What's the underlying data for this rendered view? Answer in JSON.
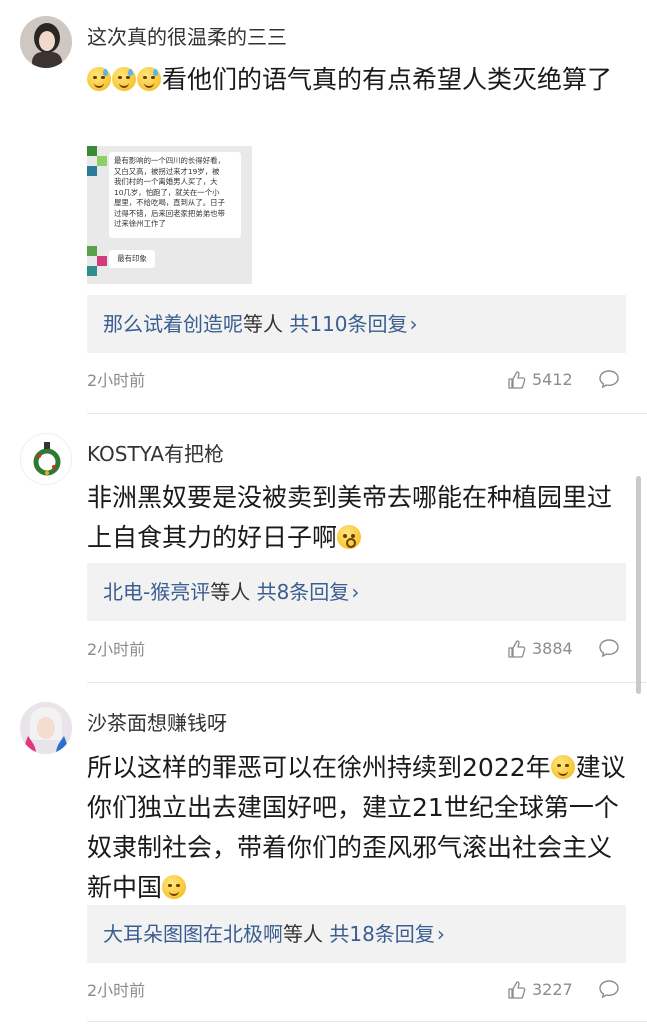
{
  "comments": [
    {
      "username": "这次真的很温柔的三三",
      "avatar_icon": "user-avatar-girl-icon",
      "text": "看他们的语气真的有点希望人类灭绝算了",
      "emojis": [
        "sweat-face-icon",
        "sweat-face-icon",
        "sweat-face-icon"
      ],
      "image": {
        "lines": [
          "最有影响的一个四川的长得好看，",
          "又白又高，被拐过来才19岁，被",
          "我们村的一个离婚男人买了，大",
          "10几岁，怕跑了，就关在一个小",
          "屋里，不给吃喝，直到从了。日子",
          "过得不错，后来回老家把弟弟也带",
          "过来徐州工作了"
        ],
        "second_bubble": "最有印象"
      },
      "reply_name": "那么试着创造呢",
      "reply_mid": "等人",
      "reply_count": "共110条回复",
      "time": "2小时前",
      "likes": "5412"
    },
    {
      "username": "KOSTYA有把枪",
      "avatar_icon": "user-avatar-wreath-icon",
      "text": "非洲黑奴要是没被卖到美帝去哪能在种植园里过上自食其力的好日子啊",
      "emojis": [
        "shocked-face-icon"
      ],
      "reply_name": "北电-猴亮评",
      "reply_mid": "等人",
      "reply_count": "共8条回复",
      "time": "2小时前",
      "likes": "3884"
    },
    {
      "username": "沙茶面想赚钱呀",
      "avatar_icon": "user-avatar-anime-icon",
      "text_part1": "所以这样的罪恶可以在徐州持续到2022年",
      "text_part2": "建议你们独立出去建国好吧，建立21世纪全球第一个奴隶制社会，带着你们的歪风邪气滚出社会主义新中国",
      "emojis": [
        "smile-face-icon",
        "smile-face-icon"
      ],
      "reply_name": "大耳朵图图在北极啊",
      "reply_mid": "等人",
      "reply_count": "共18条回复",
      "time": "2小时前",
      "likes": "3227"
    }
  ],
  "colors": {
    "link": "#3b5e91",
    "meta": "#8c8c8c",
    "reply_bg": "#f2f2f2"
  }
}
